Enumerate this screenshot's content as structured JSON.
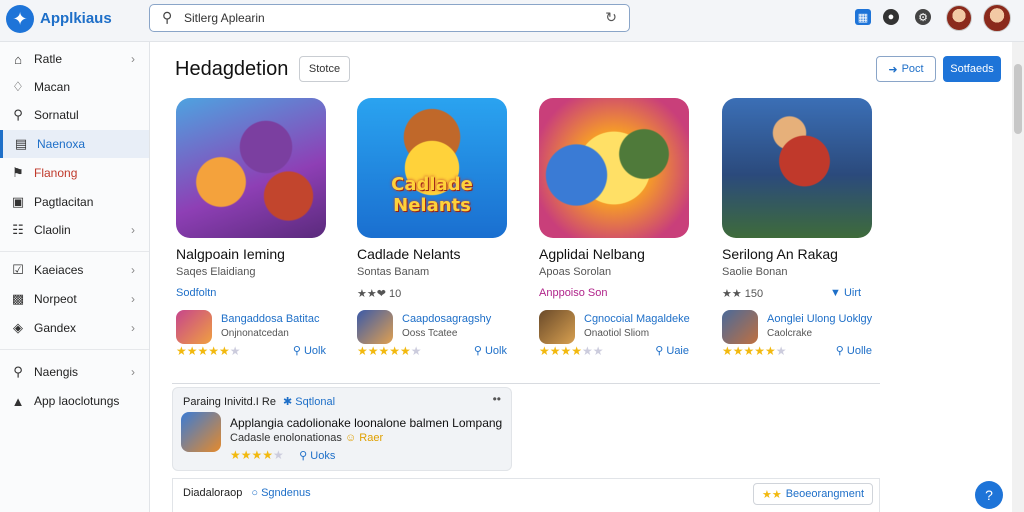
{
  "header": {
    "brand": "Applkiaus",
    "search_value": "Sitlerg Aplearin",
    "search_placeholder": "Sitlerg Aplearin"
  },
  "sidebar": {
    "items": [
      {
        "label": "Ratle",
        "icon": "home-icon",
        "chevron": true
      },
      {
        "label": "Macan",
        "icon": "tag-icon",
        "chevron": false
      },
      {
        "label": "Sornatul",
        "icon": "search-icon",
        "chevron": false
      },
      {
        "label": "Naenoxa",
        "icon": "calendar-icon",
        "chevron": false,
        "active": true
      },
      {
        "label": "Flanong",
        "icon": "flag-icon",
        "chevron": false,
        "red": true
      },
      {
        "label": "Pagtlacitan",
        "icon": "chat-icon",
        "chevron": false
      },
      {
        "label": "Claolin",
        "icon": "grid-icon",
        "chevron": true
      },
      {
        "label": "Kaeiaces",
        "icon": "check-box-icon",
        "chevron": true
      },
      {
        "label": "Norpeot",
        "icon": "window-icon",
        "chevron": true
      },
      {
        "label": "Gandex",
        "icon": "gamepad-icon",
        "chevron": true
      },
      {
        "label": "Naengis",
        "icon": "bell-icon",
        "chevron": true
      },
      {
        "label": "App laoclotungs",
        "icon": "folder-icon",
        "chevron": false
      }
    ]
  },
  "main": {
    "title": "Hedagdetion",
    "filter_label": "Stotce",
    "post_label": "Poct",
    "primary_label": "Sotfaeds",
    "cards": [
      {
        "name": "Nalgpoain Ieming",
        "sub": "Saqes Elaidiang",
        "meta": "Sodfoltn",
        "meta_color": "#1e6fc8",
        "rel_title": "Bangaddosa Batitac",
        "rel_sub": "Onjnonatcedan",
        "stars": 5,
        "like": "Uolk"
      },
      {
        "name": "Cadlade Nelants",
        "sub": "Sontas Banam",
        "meta": "★★❤ 10",
        "meta_color": "#555",
        "rel_title": "Caapdosagragshy",
        "rel_sub": "Ooss Tcatee",
        "stars": 5,
        "like": "Uolk"
      },
      {
        "name": "Agplidai Nelbang",
        "sub": "Apoas Sorolan",
        "meta": "Anppoiso Son",
        "meta_color": "#b0248a",
        "rel_title": "Cgnocoial Magaldeke",
        "rel_sub": "Onaotiol Sliom",
        "stars": 4,
        "like": "Uaie"
      },
      {
        "name": "Serilong An Rakag",
        "sub": "Saolie Bonan",
        "meta": "★★ 150",
        "meta_color": "#555",
        "rel_title": "Aonglei Ulong Uoklgy",
        "rel_sub": "Caolcrake",
        "stars": 5,
        "like": "Uolle"
      }
    ],
    "card_extra": [
      "",
      "",
      "",
      "Uirt"
    ]
  },
  "notice": {
    "head": "Paraing Inivitd.I Re",
    "tag": "Sqtlonal",
    "title": "Applangia cadolionake loonalone balmen Lompang",
    "sub": "Cadasle enolonationas",
    "sub_highlight": "Raer",
    "stars": 4,
    "link": "Uoks"
  },
  "bottom": {
    "label": "Diadaloraop",
    "tag": "Sgndenus",
    "button": "Beoeorangment"
  },
  "colors": {
    "accent": "#1e74d8",
    "star": "#f2b90f"
  }
}
